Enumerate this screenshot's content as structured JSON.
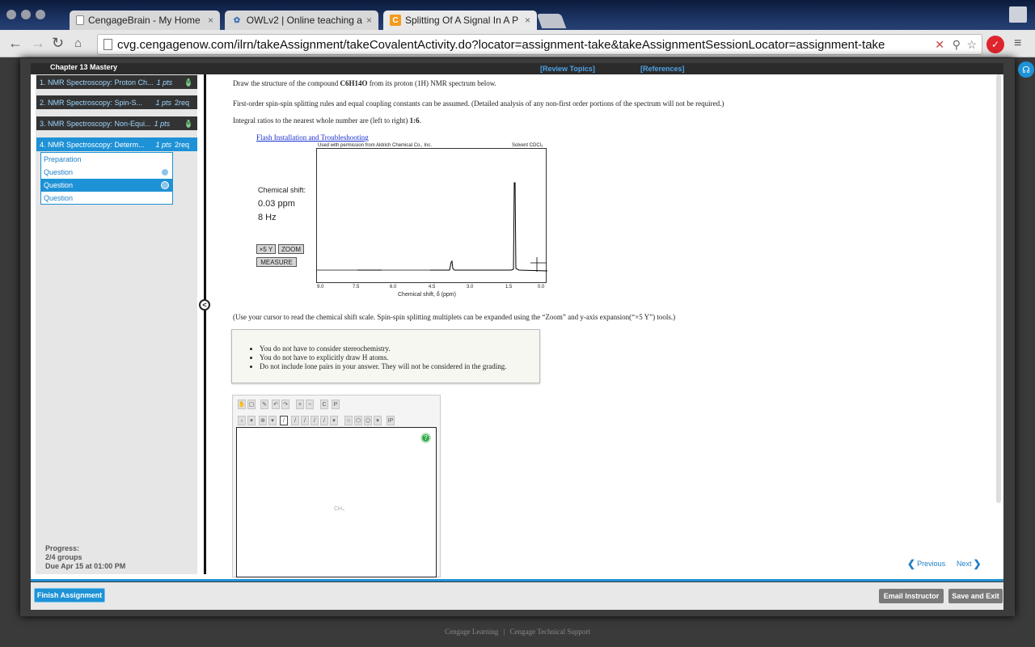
{
  "browser": {
    "tabs": [
      {
        "title": "CengageBrain - My Home",
        "icon": "page-icon"
      },
      {
        "title": "OWLv2 | Online teaching a",
        "icon": "owl-icon"
      },
      {
        "title": "Splitting Of A Signal In A P",
        "icon": "cengage-c-icon"
      }
    ],
    "url": "cvg.cengagenow.com/ilrn/takeAssignment/takeCovalentActivity.do?locator=assignment-take&takeAssignmentSessionLocator=assignment-take"
  },
  "header": {
    "chapter": "Chapter 13 Mastery",
    "review_topics": "[Review Topics]",
    "references": "[References]"
  },
  "sidebar": {
    "items": [
      {
        "label": "1. NMR Spectroscopy: Proton Ch...",
        "pts": "1 pts",
        "req": "",
        "badge": "M"
      },
      {
        "label": "2. NMR Spectroscopy: Spin-S...",
        "pts": "1 pts",
        "req": "2req",
        "badge": ""
      },
      {
        "label": "3. NMR Spectroscopy: Non-Equi...",
        "pts": "1 pts",
        "req": "",
        "badge": "M"
      },
      {
        "label": "4. NMR Spectroscopy: Determ...",
        "pts": "1 pts",
        "req": "2req",
        "badge": ""
      }
    ],
    "subitems": [
      "Preparation",
      "Question",
      "Question",
      "Question"
    ],
    "progress_label": "Progress:",
    "progress_value": "2/4 groups",
    "due": "Due Apr 15 at 01:00 PM"
  },
  "question": {
    "prompt_a": "Draw the structure of the compound ",
    "formula": "C6H14O",
    "prompt_b": " from its proton (1H) NMR spectrum below.",
    "line2": "First-order spin-spin splitting rules and equal coupling constants can be assumed. (Detailed analysis of any non-first order portions of the spectrum will not be required.)",
    "line3_a": "Integral ratios to the nearest whole number are (left to right) ",
    "line3_b": "1:6",
    "line3_c": ".",
    "flash_link": "Flash Installation and Troubleshooting",
    "chem_shift_label": "Chemical shift:",
    "chem_shift_ppm": "0.03 ppm",
    "chem_shift_hz": "8 Hz",
    "btn_x5y": "×5 Y",
    "btn_zoom": "ZOOM",
    "btn_measure": "MEASURE",
    "spectrum_credit": "Used with permission from Aldrich Chemical Co., Inc.",
    "spectrum_solvent": "Solvent CDCl₃",
    "spectrum_axis_label": "Chemical shift, δ (ppm)",
    "spectrum_ticks": [
      "9.0",
      "7.5",
      "6.0",
      "4.5",
      "3.0",
      "1.5",
      "0.0"
    ],
    "cursor_note": "(Use your cursor to read the chemical shift scale. Spin-spin splitting multiplets can be expanded using the “Zoom” and y-axis expansion(“×5 Y”) tools.)",
    "notes": [
      "You do not have to consider stereochemistry.",
      "You do not have to explicitly draw H atoms.",
      "Do not include lone pairs in your answer. They will not be considered in the grading."
    ],
    "canvas_placeholder": "CH₄"
  },
  "nav": {
    "previous": "Previous",
    "next": "Next"
  },
  "footer_buttons": {
    "finish": "Finish Assignment",
    "email": "Email Instructor",
    "save": "Save and Exit"
  },
  "footer": {
    "left": "Cengage Learning",
    "sep": "|",
    "right": "Cengage Technical Support"
  },
  "colors": {
    "accent": "#1e92d6",
    "dark": "#2b2b2b",
    "owl_red": "#e0242d"
  }
}
